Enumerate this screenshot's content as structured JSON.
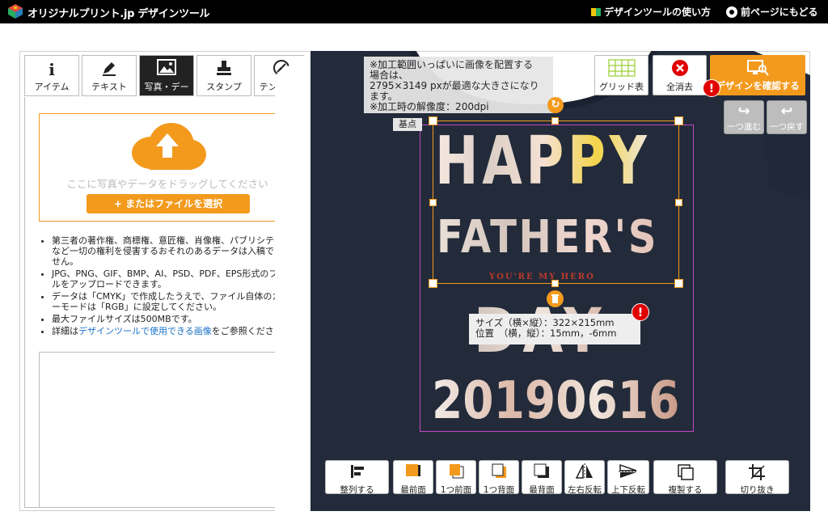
{
  "header": {
    "logo_text": "オリジナルプリント.jp デザインツール",
    "help_link": "デザインツールの使い方",
    "back_link": "前ページにもどる"
  },
  "tabs": [
    {
      "label": "アイテム",
      "icon": "info-icon"
    },
    {
      "label": "テキスト",
      "icon": "pen-icon"
    },
    {
      "label": "写真・デー",
      "icon": "image-icon",
      "active": true
    },
    {
      "label": "スタンプ",
      "icon": "stamp-icon"
    },
    {
      "label": "テンプレー",
      "icon": "template-icon"
    }
  ],
  "upload": {
    "drop_text": "ここに写真やデータをドラッグしてください",
    "file_button": "+ またはファイルを選択"
  },
  "notes": [
    "第三者の著作権、商標権、意匠権、肖像権、パブリシティ権など一切の権利を侵害するおそれのあるデータは入稿できません。",
    "JPG、PNG、GIF、BMP、AI、PSD、PDF、EPS形式のファイルをアップロードできます。",
    "データは「CMYK」で作成したうえで、ファイル自体のカラーモードは「RGB」に設定してください。",
    "最大ファイルサイズは500MBです。"
  ],
  "notes_last": {
    "prefix": "詳細は",
    "link": "デザインツールで使用できる画像",
    "suffix": "をご参照ください。"
  },
  "canvas": {
    "tooltip_lines": [
      "※加工範囲いっぱいに画像を配置する",
      "場合は、",
      "2795×3149 pxが最適な大きさになり",
      "ます。",
      "※加工時の解像度：200dpi"
    ],
    "origin_label": "基点",
    "art_happy": "HAPPY",
    "art_father": "FATHER'S",
    "art_hero": "YOU'RE MY HERO",
    "art_day": "DAY",
    "art_date": "20190616",
    "info_size": "サイズ（横×縦）：322×215mm",
    "info_position": "位置　（横，縦）：15mm，-6mm",
    "warn_mark": "!"
  },
  "top_buttons": {
    "grid": "グリッド表",
    "clear": "全消去",
    "confirm": "デザインを確認する",
    "redo": "一つ進む",
    "undo": "一つ戻す"
  },
  "bottom_buttons": [
    {
      "label": "整列する",
      "icon": "align-icon"
    },
    {
      "label": "最前面",
      "icon": "bring-front-icon"
    },
    {
      "label": "1つ前面",
      "icon": "bring-forward-icon"
    },
    {
      "label": "1つ背面",
      "icon": "send-backward-icon"
    },
    {
      "label": "最背面",
      "icon": "send-back-icon"
    },
    {
      "label": "左右反転",
      "icon": "flip-horizontal-icon"
    },
    {
      "label": "上下反転",
      "icon": "flip-vertical-icon"
    },
    {
      "label": "複製する",
      "icon": "duplicate-icon"
    },
    {
      "label": "切り抜き",
      "icon": "crop-icon"
    }
  ],
  "colors": {
    "accent": "#f39a1d",
    "shirt": "#232b3a",
    "print_area": "#c048c0",
    "warning": "#e00000"
  }
}
